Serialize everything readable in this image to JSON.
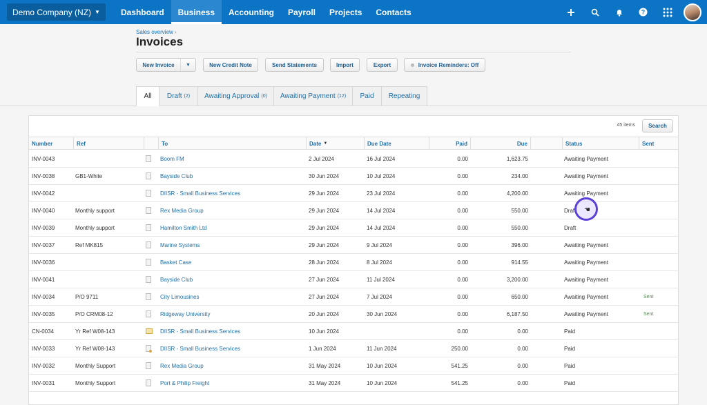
{
  "topnav": {
    "org_name": "Demo Company (NZ)",
    "links": [
      "Dashboard",
      "Business",
      "Accounting",
      "Payroll",
      "Projects",
      "Contacts"
    ],
    "active": "Business",
    "icons": [
      "plus-icon",
      "search-icon",
      "bell-icon",
      "help-icon",
      "apps-grid-icon"
    ]
  },
  "header": {
    "breadcrumb": "Sales overview",
    "breadcrumb_sep": "›",
    "title": "Invoices"
  },
  "toolbar": {
    "new_invoice": "New Invoice",
    "new_credit_note": "New Credit Note",
    "send_statements": "Send Statements",
    "import": "Import",
    "export": "Export",
    "reminders": "Invoice Reminders: Off"
  },
  "tabs": [
    {
      "label": "All",
      "count": ""
    },
    {
      "label": "Draft",
      "count": "(2)"
    },
    {
      "label": "Awaiting Approval",
      "count": "(0)"
    },
    {
      "label": "Awaiting Payment",
      "count": "(12)"
    },
    {
      "label": "Paid",
      "count": ""
    },
    {
      "label": "Repeating",
      "count": ""
    }
  ],
  "table": {
    "items_count": "45 items",
    "search_label": "Search",
    "columns": [
      "Number",
      "Ref",
      "",
      "To",
      "Date",
      "Due Date",
      "Paid",
      "Due",
      "",
      "Status",
      "Sent"
    ],
    "rows": [
      {
        "number": "INV-0043",
        "ref": "",
        "to": "Boom FM",
        "date": "2 Jul 2024",
        "due_date": "16 Jul 2024",
        "paid": "0.00",
        "due": "1,623.75",
        "status": "Awaiting Payment",
        "sent": "",
        "doc": "plain"
      },
      {
        "number": "INV-0038",
        "ref": "GB1-White",
        "to": "Bayside Club",
        "date": "30 Jun 2024",
        "due_date": "10 Jul 2024",
        "paid": "0.00",
        "due": "234.00",
        "status": "Awaiting Payment",
        "sent": "",
        "doc": "plain"
      },
      {
        "number": "INV-0042",
        "ref": "",
        "to": "DIISR - Small Business Services",
        "date": "29 Jun 2024",
        "due_date": "23 Jul 2024",
        "paid": "0.00",
        "due": "4,200.00",
        "status": "Awaiting Payment",
        "sent": "",
        "doc": "plain"
      },
      {
        "number": "INV-0040",
        "ref": "Monthly support",
        "to": "Rex Media Group",
        "date": "29 Jun 2024",
        "due_date": "14 Jul 2024",
        "paid": "0.00",
        "due": "550.00",
        "status": "Draft",
        "sent": "",
        "doc": "plain"
      },
      {
        "number": "INV-0039",
        "ref": "Monthly support",
        "to": "Hamilton Smith Ltd",
        "date": "29 Jun 2024",
        "due_date": "14 Jul 2024",
        "paid": "0.00",
        "due": "550.00",
        "status": "Draft",
        "sent": "",
        "doc": "plain"
      },
      {
        "number": "INV-0037",
        "ref": "Ref MK815",
        "to": "Marine Systems",
        "date": "29 Jun 2024",
        "due_date": "9 Jul 2024",
        "paid": "0.00",
        "due": "396.00",
        "status": "Awaiting Payment",
        "sent": "",
        "doc": "plain"
      },
      {
        "number": "INV-0036",
        "ref": "",
        "to": "Basket Case",
        "date": "28 Jun 2024",
        "due_date": "8 Jul 2024",
        "paid": "0.00",
        "due": "914.55",
        "status": "Awaiting Payment",
        "sent": "",
        "doc": "plain"
      },
      {
        "number": "INV-0041",
        "ref": "",
        "to": "Bayside Club",
        "date": "27 Jun 2024",
        "due_date": "11 Jul 2024",
        "paid": "0.00",
        "due": "3,200.00",
        "status": "Awaiting Payment",
        "sent": "",
        "doc": "plain"
      },
      {
        "number": "INV-0034",
        "ref": "P/O 9711",
        "to": "City Limousines",
        "date": "27 Jun 2024",
        "due_date": "7 Jul 2024",
        "paid": "0.00",
        "due": "650.00",
        "status": "Awaiting Payment",
        "sent": "Sent",
        "doc": "plain"
      },
      {
        "number": "INV-0035",
        "ref": "P/O CRM08-12",
        "to": "Ridgeway University",
        "date": "20 Jun 2024",
        "due_date": "30 Jun 2024",
        "paid": "0.00",
        "due": "6,187.50",
        "status": "Awaiting Payment",
        "sent": "Sent",
        "doc": "plain"
      },
      {
        "number": "CN-0034",
        "ref": "Yr Ref W08-143",
        "to": "DIISR - Small Business Services",
        "date": "10 Jun 2024",
        "due_date": "",
        "paid": "0.00",
        "due": "0.00",
        "status": "Paid",
        "sent": "",
        "doc": "cn"
      },
      {
        "number": "INV-0033",
        "ref": "Yr Ref W08-143",
        "to": "DIISR - Small Business Services",
        "date": "1 Jun 2024",
        "due_date": "11 Jun 2024",
        "paid": "250.00",
        "due": "0.00",
        "status": "Paid",
        "sent": "",
        "doc": "clip"
      },
      {
        "number": "INV-0032",
        "ref": "Monthly Support",
        "to": "Rex Media Group",
        "date": "31 May 2024",
        "due_date": "10 Jun 2024",
        "paid": "541.25",
        "due": "0.00",
        "status": "Paid",
        "sent": "",
        "doc": "plain"
      },
      {
        "number": "INV-0031",
        "ref": "Monthly Support",
        "to": "Port & Philip Freight",
        "date": "31 May 2024",
        "due_date": "10 Jun 2024",
        "paid": "541.25",
        "due": "0.00",
        "status": "Paid",
        "sent": "",
        "doc": "plain"
      }
    ]
  },
  "colors": {
    "nav": "#0b74c4",
    "link": "#1f6fa8",
    "sent": "#3c9a3c",
    "cursor": "#5b3fd6"
  }
}
